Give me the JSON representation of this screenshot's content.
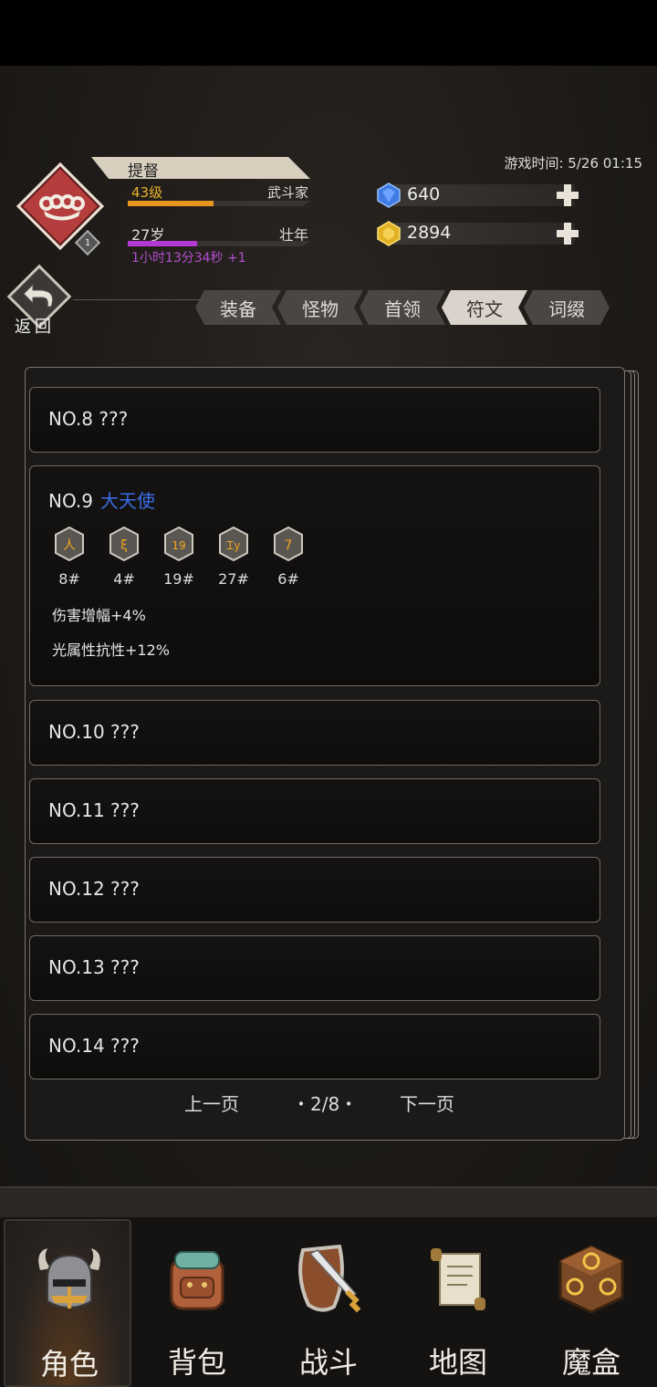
{
  "header": {
    "char_name": "提督",
    "level_text": "43级",
    "class_text": "武斗家",
    "exp_fraction": 0.47,
    "badge_number": "1",
    "age_text": "27岁",
    "stage_text": "壮年",
    "age_fraction": 0.38,
    "age_timer": "1小时13分34秒 +1",
    "game_time": "游戏时间: 5/26 01:15",
    "currencies": [
      {
        "icon": "blue-gem-icon",
        "value": "640",
        "color": "#3f7be3"
      },
      {
        "icon": "gold-coin-icon",
        "value": "2894",
        "color": "#e2b126"
      }
    ]
  },
  "back_button": {
    "label": "返回"
  },
  "tabs": [
    {
      "label": "装备",
      "active": false
    },
    {
      "label": "怪物",
      "active": false
    },
    {
      "label": "首领",
      "active": false
    },
    {
      "label": "符文",
      "active": true
    },
    {
      "label": "词缀",
      "active": false
    }
  ],
  "entries": [
    {
      "title": "NO.8 ???"
    },
    {
      "title": "NO.9",
      "rune_name": "大天使",
      "runes": [
        {
          "glyph": "人",
          "count": "8#"
        },
        {
          "glyph": "ξ",
          "count": "4#"
        },
        {
          "glyph": "19",
          "count": "19#"
        },
        {
          "glyph": "Ꮖy",
          "count": "27#"
        },
        {
          "glyph": "7",
          "count": "6#"
        }
      ],
      "stats": [
        "伤害增幅+4%",
        "光属性抗性+12%"
      ]
    },
    {
      "title": "NO.10 ???"
    },
    {
      "title": "NO.11 ???"
    },
    {
      "title": "NO.12 ???"
    },
    {
      "title": "NO.13 ???"
    },
    {
      "title": "NO.14 ???"
    }
  ],
  "pager": {
    "prev": "上一页",
    "page": "・2/8・",
    "next": "下一页"
  },
  "nav": [
    {
      "label": "角色",
      "icon": "helmet-icon",
      "active": true
    },
    {
      "label": "背包",
      "icon": "backpack-icon",
      "active": false
    },
    {
      "label": "战斗",
      "icon": "sword-shield-icon",
      "active": false
    },
    {
      "label": "地图",
      "icon": "scroll-map-icon",
      "active": false
    },
    {
      "label": "魔盒",
      "icon": "magic-box-icon",
      "active": false
    }
  ],
  "colors": {
    "rune_name": "#3a6ee8",
    "level": "#e8b52c",
    "timer": "#b34fcf",
    "badge": "#b53d3d"
  }
}
